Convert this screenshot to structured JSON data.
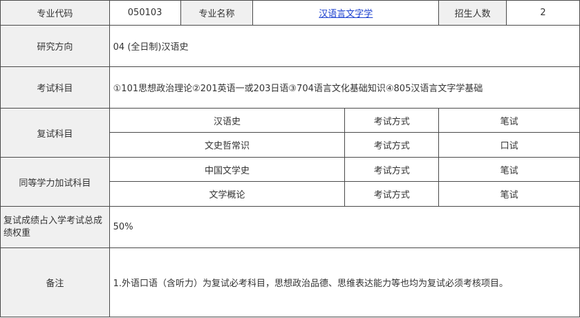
{
  "header": {
    "code_label": "专业代码",
    "code_value": "050103",
    "name_label": "专业名称",
    "name_value": "汉语言文字学",
    "enroll_label": "招生人数",
    "enroll_value": "2"
  },
  "research": {
    "label": "研究方向",
    "value": "04 (全日制)汉语史"
  },
  "exam_subjects": {
    "label": "考试科目",
    "value": "①101思想政治理论②201英语一或203日语③704语言文化基础知识④805汉语言文字学基础"
  },
  "retest": {
    "label": "复试科目",
    "rows": [
      {
        "subject": "汉语史",
        "method_label": "考试方式",
        "method": "笔试"
      },
      {
        "subject": "文史哲常识",
        "method_label": "考试方式",
        "method": "口试"
      }
    ]
  },
  "extra": {
    "label": "同等学力加试科目",
    "rows": [
      {
        "subject": "中国文学史",
        "method_label": "考试方式",
        "method": "笔试"
      },
      {
        "subject": "文学概论",
        "method_label": "考试方式",
        "method": "笔试"
      }
    ]
  },
  "weight": {
    "label": "复试成绩占入学考试总成绩权重",
    "value": "50%"
  },
  "remarks": {
    "label": "备注",
    "value": "1.外语口语（含听力）为复试必考科目，思想政治品德、思维表达能力等也均为复试必须考核项目。"
  }
}
